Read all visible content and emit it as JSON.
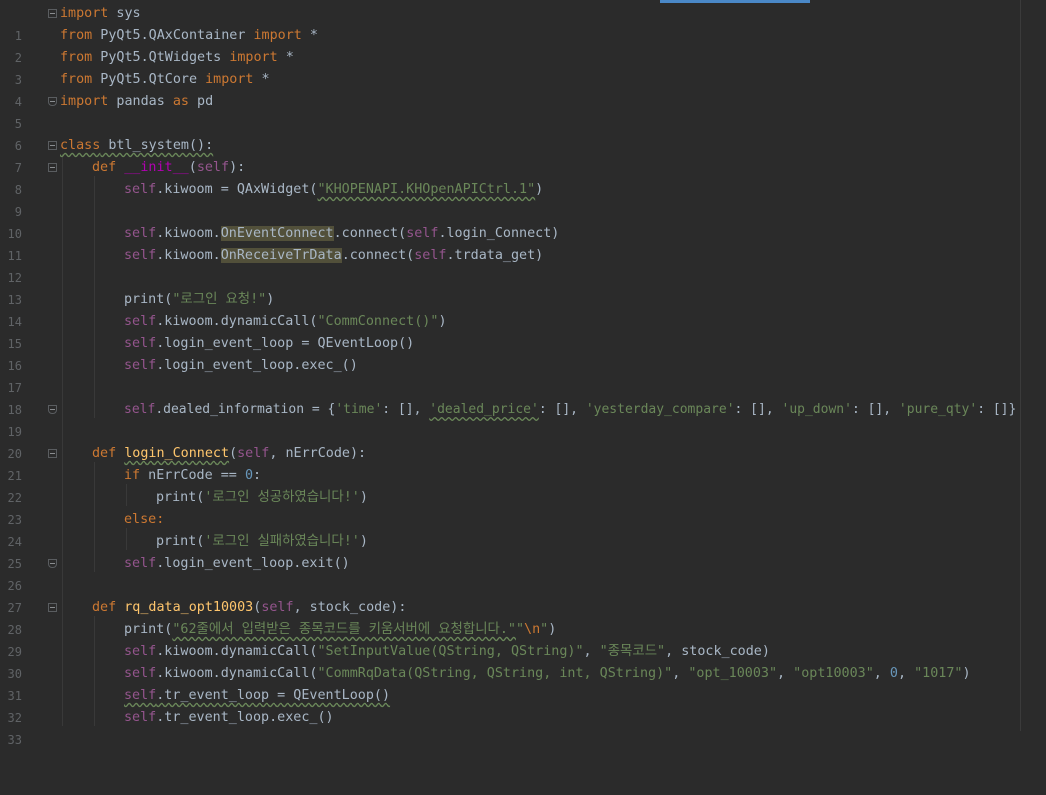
{
  "editor": {
    "lines": [
      {
        "n": "1"
      },
      {
        "n": "2"
      },
      {
        "n": "3"
      },
      {
        "n": "4"
      },
      {
        "n": "5"
      },
      {
        "n": "6"
      },
      {
        "n": "7"
      },
      {
        "n": "8"
      },
      {
        "n": "9"
      },
      {
        "n": "10"
      },
      {
        "n": "11"
      },
      {
        "n": "12"
      },
      {
        "n": "13"
      },
      {
        "n": "14"
      },
      {
        "n": "15"
      },
      {
        "n": "16"
      },
      {
        "n": "17"
      },
      {
        "n": "18"
      },
      {
        "n": "19"
      },
      {
        "n": "20"
      },
      {
        "n": "21"
      },
      {
        "n": "22"
      },
      {
        "n": "23"
      },
      {
        "n": "24"
      },
      {
        "n": "25"
      },
      {
        "n": "26"
      },
      {
        "n": "27"
      },
      {
        "n": "28"
      },
      {
        "n": "29"
      },
      {
        "n": "30"
      },
      {
        "n": "31"
      },
      {
        "n": "32"
      },
      {
        "n": "33"
      }
    ],
    "t": {
      "import": "import",
      "from": "from",
      "as": "as",
      "class": "class",
      "def": "def",
      "if": "if",
      "else": "else:",
      "self": "self",
      "l1_rest": " sys",
      "l2_mod": " PyQt5.QAxContainer ",
      "star": " *",
      "l3_mod": " PyQt5.QtWidgets ",
      "l4_mod": " PyQt5.QtCore ",
      "l5_mod": " pandas ",
      "l5_pd": " pd",
      "l7_name": " btl_system():",
      "l8_init": "__init__",
      "l8_a": "(",
      "l8_b": "):",
      "l8_sp": " ",
      "l9_a": ".kiwoom = QAxWidget(",
      "l9_s": "\"KHOPENAPI.KHOpenAPICtrl.1\"",
      "l9_b": ")",
      "kiwoom_dot": ".kiwoom.",
      "l11_hl": "OnEventConnect",
      "l11_a": ".connect(",
      "l11_b": ".login_Connect)",
      "l12_hl": "OnReceiveTrData",
      "l12_b": ".trdata_get)",
      "print_open": "print(",
      "close_paren": ")",
      "l14_s": "\"로그인 요청!\"",
      "l15_a": ".kiwoom.dynamicCall(",
      "l15_s": "\"CommConnect()\"",
      "l16_a": ".login_event_loop = QEventLoop()",
      "l17_a": ".login_event_loop.exec_()",
      "l19_a": ".dealed_information = {",
      "l19_k1": "'time'",
      "l19_c": ": [], ",
      "l19_k2": "'dealed_price'",
      "l19_k3": "'yesterday_compare'",
      "l19_k4": "'up_down'",
      "l19_k5": "'pure_qty'",
      "l19_end": ": []}",
      "l21_name": "login_Connect",
      "l21_a": "(",
      "l21_b": ", nErrCode):",
      "l22_a": " nErrCode == ",
      "l22_n": "0",
      "l22_b": ":",
      "l23_s": "'로그인 성공하였습니다!'",
      "l25_s": "'로그인 실패하였습니다!'",
      "l26_a": ".login_event_loop.exit()",
      "l28_name": "rq_data_opt10003",
      "l28_b": ", stock_code):",
      "l29_s": "\"62줄에서 입력받은 종목코드를 키움서버에 요청합니다.\"",
      "l29_s2": "\"",
      "l29_esc": "\\n",
      "l29_s3": "\"",
      "l30_a": ".kiwoom.dynamicCall(",
      "l30_s1": "\"SetInputValue(QString, QString)\"",
      "comma": ", ",
      "l30_s2": "\"종목코드\"",
      "l30_b": ", stock_code)",
      "l31_s1": "\"CommRqData(QString, QString, int, QString)\"",
      "l31_s2": "\"opt_10003\"",
      "l31_s3": "\"opt10003\"",
      "l31_n": "0",
      "l31_s4": "\"1017\"",
      "l32_a": ".tr_event_loop = QEventLoop()",
      "l33_a": ".tr_event_loop.exec_()"
    }
  }
}
